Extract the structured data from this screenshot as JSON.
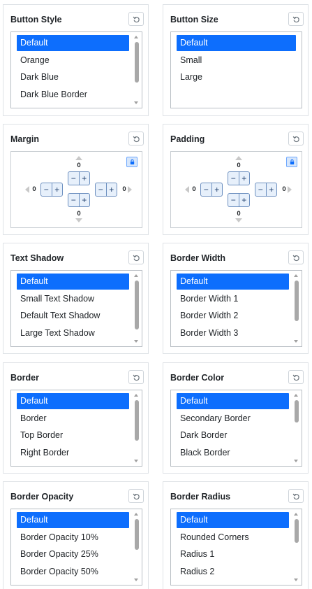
{
  "colors": {
    "accent": "#0d6efd",
    "border": "#dee2e6"
  },
  "icons": {
    "reset": "undo-arrow-icon",
    "lock": "lock-icon"
  },
  "panels": {
    "button_style": {
      "title": "Button Style",
      "items": [
        "Default",
        "Orange",
        "Dark Blue",
        "Dark Blue Border"
      ],
      "selected": 0
    },
    "button_size": {
      "title": "Button Size",
      "items": [
        "Default",
        "Small",
        "Large"
      ],
      "selected": 0
    },
    "margin": {
      "title": "Margin",
      "top": "0",
      "right": "0",
      "bottom": "0",
      "left": "0",
      "plus": "+",
      "minus": "−"
    },
    "padding": {
      "title": "Padding",
      "top": "0",
      "right": "0",
      "bottom": "0",
      "left": "0",
      "plus": "+",
      "minus": "−"
    },
    "text_shadow": {
      "title": "Text Shadow",
      "items": [
        "Default",
        "Small Text Shadow",
        "Default Text Shadow",
        "Large Text Shadow"
      ],
      "selected": 0
    },
    "border_width": {
      "title": "Border Width",
      "items": [
        "Default",
        "Border Width 1",
        "Border Width 2",
        "Border Width 3"
      ],
      "selected": 0
    },
    "border": {
      "title": "Border",
      "items": [
        "Default",
        "Border",
        "Top Border",
        "Right Border"
      ],
      "selected": 0
    },
    "border_color": {
      "title": "Border Color",
      "items": [
        "Default",
        "Secondary Border",
        "Dark Border",
        "Black Border"
      ],
      "selected": 0
    },
    "border_opacity": {
      "title": "Border Opacity",
      "items": [
        "Default",
        "Border Opacity 10%",
        "Border Opacity 25%",
        "Border Opacity 50%"
      ],
      "selected": 0
    },
    "border_radius": {
      "title": "Border Radius",
      "items": [
        "Default",
        "Rounded Corners",
        "Radius 1",
        "Radius 2"
      ],
      "selected": 0
    }
  }
}
